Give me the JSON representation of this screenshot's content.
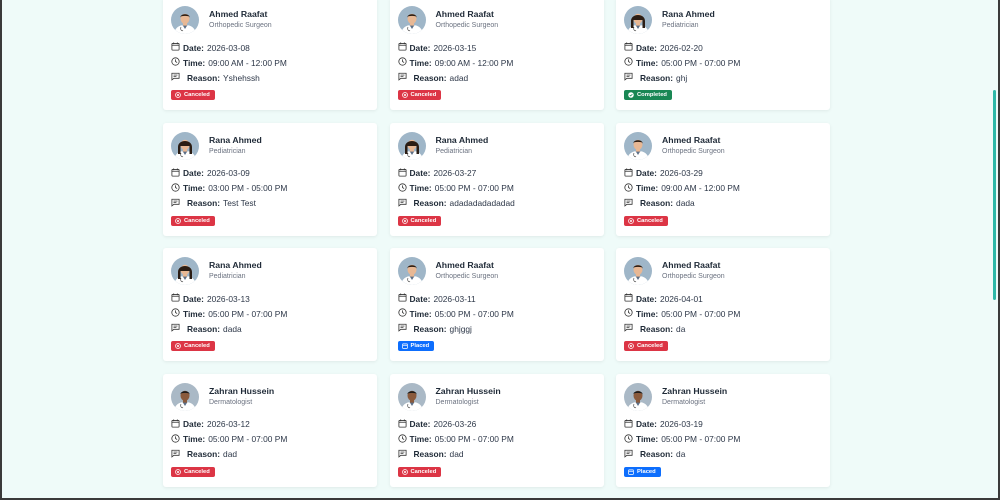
{
  "labels": {
    "date": "Date:",
    "time": "Time:",
    "reason": "Reason:"
  },
  "status_colors": {
    "Canceled": "#dc3545",
    "Completed": "#198754",
    "Placed": "#0d6efd"
  },
  "appointments": [
    {
      "doctor": "Ahmed Raafat",
      "specialty": "Orthopedic Surgeon",
      "date": "2026-03-08",
      "time": "09:00 AM - 12:00 PM",
      "reason": "Yshehssh",
      "status": "Canceled",
      "avatar": "male-doctor"
    },
    {
      "doctor": "Ahmed Raafat",
      "specialty": "Orthopedic Surgeon",
      "date": "2026-03-15",
      "time": "09:00 AM - 12:00 PM",
      "reason": "adad",
      "status": "Canceled",
      "avatar": "male-doctor"
    },
    {
      "doctor": "Rana Ahmed",
      "specialty": "Pediatrician",
      "date": "2026-02-20",
      "time": "05:00 PM - 07:00 PM",
      "reason": "ghj",
      "status": "Completed",
      "avatar": "female-doctor"
    },
    {
      "doctor": "Rana Ahmed",
      "specialty": "Pediatrician",
      "date": "2026-03-09",
      "time": "03:00 PM - 05:00 PM",
      "reason": "Test Test",
      "status": "Canceled",
      "avatar": "female-doctor"
    },
    {
      "doctor": "Rana Ahmed",
      "specialty": "Pediatrician",
      "date": "2026-03-27",
      "time": "05:00 PM - 07:00 PM",
      "reason": "adadadadadadad",
      "status": "Canceled",
      "avatar": "female-doctor"
    },
    {
      "doctor": "Ahmed Raafat",
      "specialty": "Orthopedic Surgeon",
      "date": "2026-03-29",
      "time": "09:00 AM - 12:00 PM",
      "reason": "dada",
      "status": "Canceled",
      "avatar": "male-doctor"
    },
    {
      "doctor": "Rana Ahmed",
      "specialty": "Pediatrician",
      "date": "2026-03-13",
      "time": "05:00 PM - 07:00 PM",
      "reason": "dada",
      "status": "Canceled",
      "avatar": "female-doctor"
    },
    {
      "doctor": "Ahmed Raafat",
      "specialty": "Orthopedic Surgeon",
      "date": "2026-03-11",
      "time": "05:00 PM - 07:00 PM",
      "reason": "ghjggj",
      "status": "Placed",
      "avatar": "male-doctor"
    },
    {
      "doctor": "Ahmed Raafat",
      "specialty": "Orthopedic Surgeon",
      "date": "2026-04-01",
      "time": "05:00 PM - 07:00 PM",
      "reason": "da",
      "status": "Canceled",
      "avatar": "male-doctor"
    },
    {
      "doctor": "Zahran Hussein",
      "specialty": "Dermatologist",
      "date": "2026-03-12",
      "time": "05:00 PM - 07:00 PM",
      "reason": "dad",
      "status": "Canceled",
      "avatar": "dark-male-doctor"
    },
    {
      "doctor": "Zahran Hussein",
      "specialty": "Dermatologist",
      "date": "2026-03-26",
      "time": "05:00 PM - 07:00 PM",
      "reason": "dad",
      "status": "Canceled",
      "avatar": "dark-male-doctor"
    },
    {
      "doctor": "Zahran Hussein",
      "specialty": "Dermatologist",
      "date": "2026-03-19",
      "time": "05:00 PM - 07:00 PM",
      "reason": "da",
      "status": "Placed",
      "avatar": "dark-male-doctor"
    }
  ]
}
